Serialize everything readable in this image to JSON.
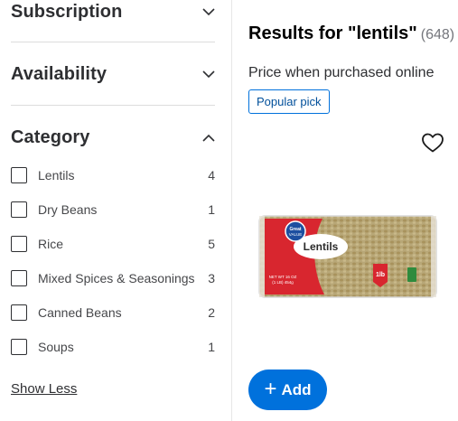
{
  "filters": {
    "subscription": {
      "title": "Subscription",
      "icon": "chevron-down-icon"
    },
    "availability": {
      "title": "Availability",
      "icon": "chevron-down-icon"
    },
    "category": {
      "title": "Category",
      "icon": "chevron-up-icon",
      "items": [
        {
          "label": "Lentils",
          "count": "4",
          "checked": false
        },
        {
          "label": "Dry Beans",
          "count": "1",
          "checked": false
        },
        {
          "label": "Rice",
          "count": "5",
          "checked": false
        },
        {
          "label": "Mixed Spices & Seasonings",
          "count": "3",
          "checked": false
        },
        {
          "label": "Canned Beans",
          "count": "2",
          "checked": false
        },
        {
          "label": "Soups",
          "count": "1",
          "checked": false
        }
      ],
      "show_less": "Show Less"
    }
  },
  "results": {
    "title": "Results for \"lentils\"",
    "count": "(648)",
    "price_note": "Price when purchased online",
    "badge": "Popular pick",
    "favorite_icon": "heart-outline-icon",
    "product": {
      "brand_logo": "Great Value",
      "package_label": "Lentils",
      "net_weight": "NET WT 16 OZ (1 LB) 454g",
      "size_badge": "1lb"
    },
    "add_button": {
      "plus": "+",
      "label": "Add"
    }
  },
  "colors": {
    "accent_blue": "#0071dc",
    "text_dark": "#2e2f32",
    "muted": "#74767c",
    "package_red": "#d8262f"
  }
}
